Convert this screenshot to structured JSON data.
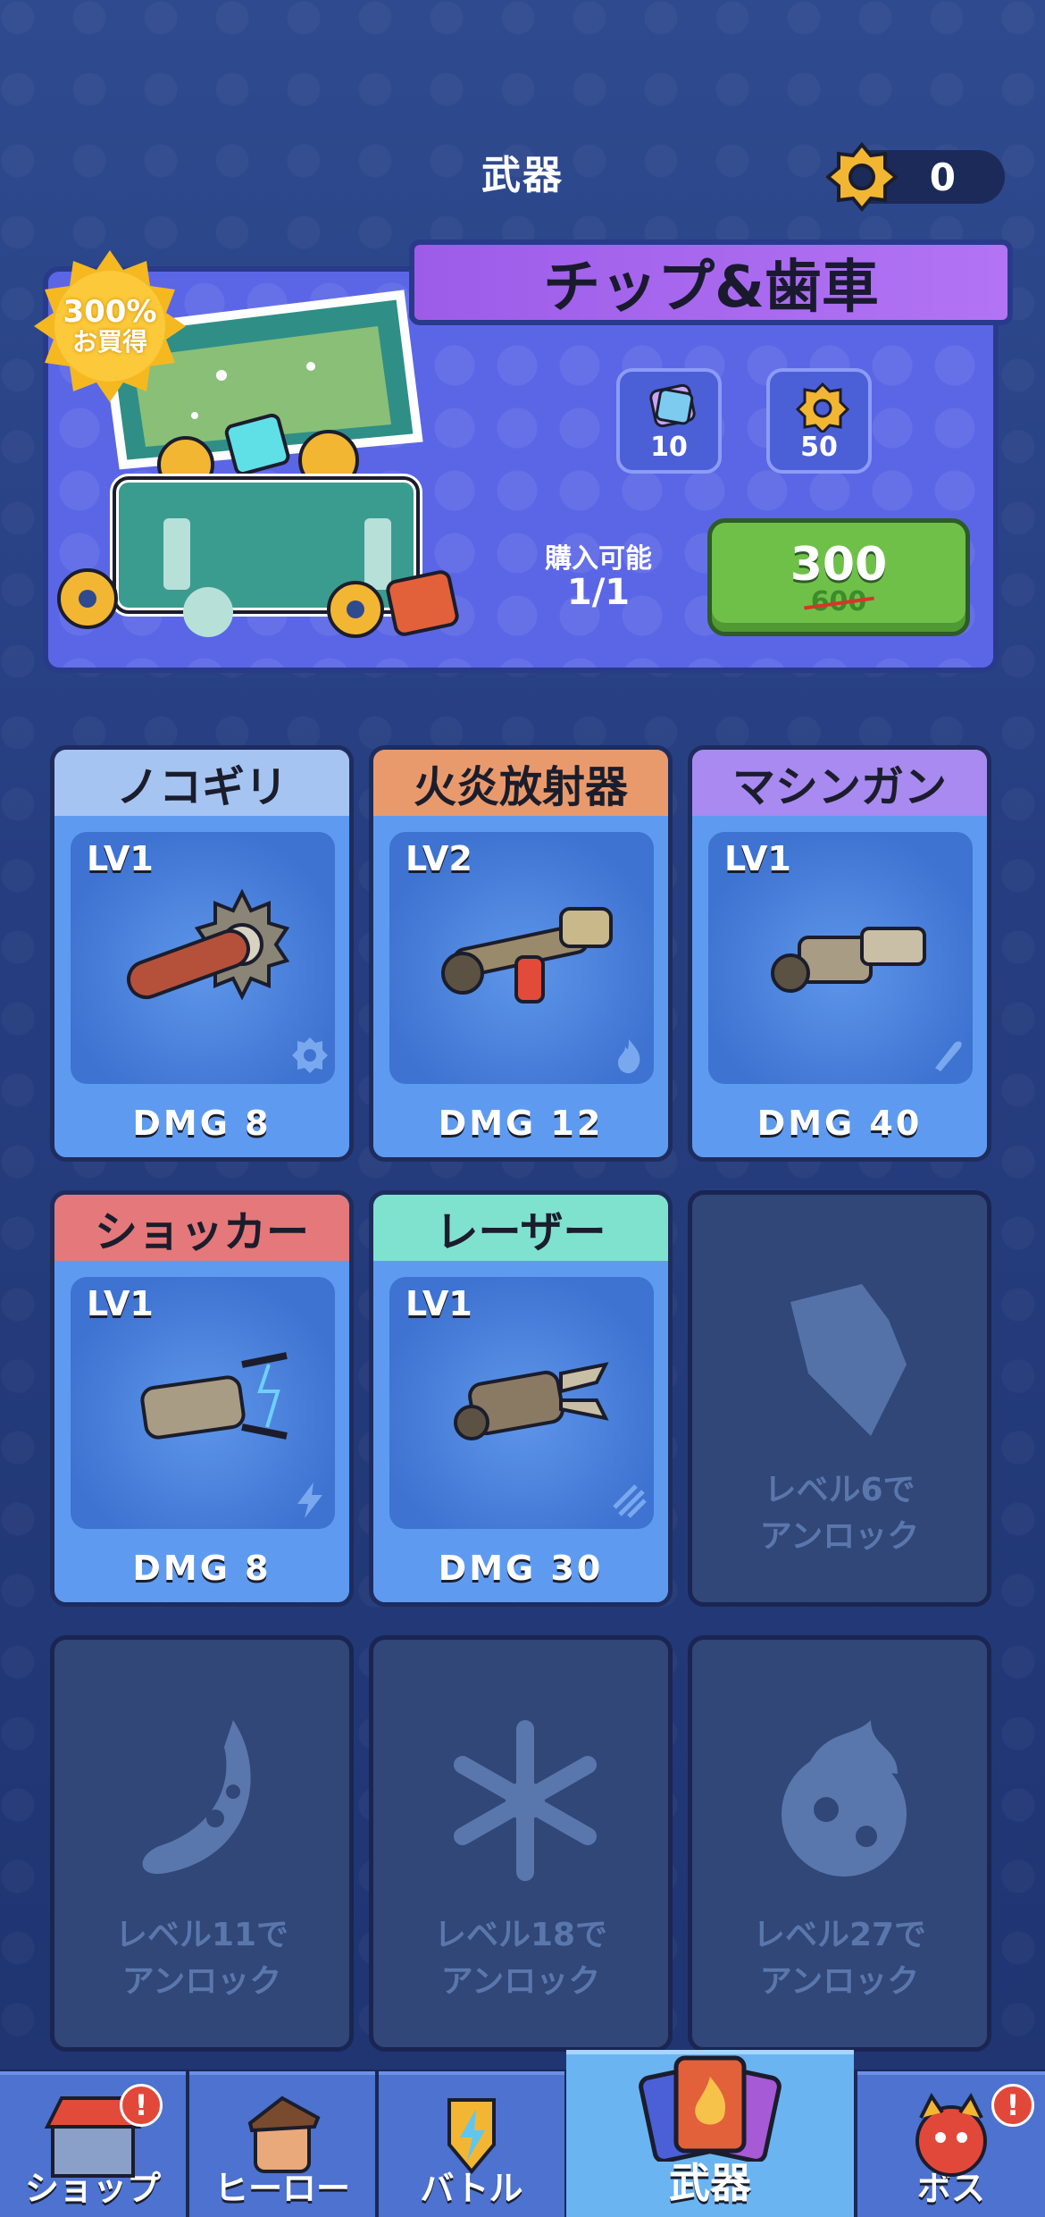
{
  "header": {
    "title": "武器",
    "currency_value": "0"
  },
  "offer": {
    "ribbon_title": "チップ&歯車",
    "bonus_badge_line1": "300%",
    "bonus_badge_line2": "お買得",
    "rewards": [
      {
        "icon": "chip-icon",
        "amount": "10"
      },
      {
        "icon": "gear-icon",
        "amount": "50"
      }
    ],
    "availability_label": "購入可能",
    "availability_value": "1/1",
    "price": "300",
    "old_price": "600"
  },
  "weapons": [
    {
      "name": "ノコギリ",
      "level": "LV1",
      "dmg": "DMG 8",
      "header_color": "#a6c4f1",
      "type_icon": "gear-type-icon"
    },
    {
      "name": "火炎放射器",
      "level": "LV2",
      "dmg": "DMG 12",
      "header_color": "#e99a6c",
      "type_icon": "fire-type-icon"
    },
    {
      "name": "マシンガン",
      "level": "LV1",
      "dmg": "DMG 40",
      "header_color": "#a88af0",
      "type_icon": "bullet-type-icon"
    },
    {
      "name": "ショッカー",
      "level": "LV1",
      "dmg": "DMG 8",
      "header_color": "#e4787a",
      "type_icon": "lightning-type-icon"
    },
    {
      "name": "レーザー",
      "level": "LV1",
      "dmg": "DMG 30",
      "header_color": "#7fe2cf",
      "type_icon": "laser-type-icon"
    }
  ],
  "locked": [
    {
      "icon": "bomb-icon",
      "line1": "レベル6で",
      "line2": "アンロック"
    },
    {
      "icon": "boomerang-icon",
      "line1": "レベル11で",
      "line2": "アンロック"
    },
    {
      "icon": "snowflake-icon",
      "line1": "レベル18で",
      "line2": "アンロック"
    },
    {
      "icon": "fireball-icon",
      "line1": "レベル27で",
      "line2": "アンロック"
    }
  ],
  "nav": [
    {
      "label": "ショップ",
      "icon": "shop-icon",
      "badge": "!"
    },
    {
      "label": "ヒーロー",
      "icon": "hero-icon"
    },
    {
      "label": "バトル",
      "icon": "battle-icon"
    },
    {
      "label": "武器",
      "icon": "weapon-cards-icon",
      "active": true
    },
    {
      "label": "ボス",
      "icon": "boss-icon",
      "badge": "!"
    }
  ]
}
